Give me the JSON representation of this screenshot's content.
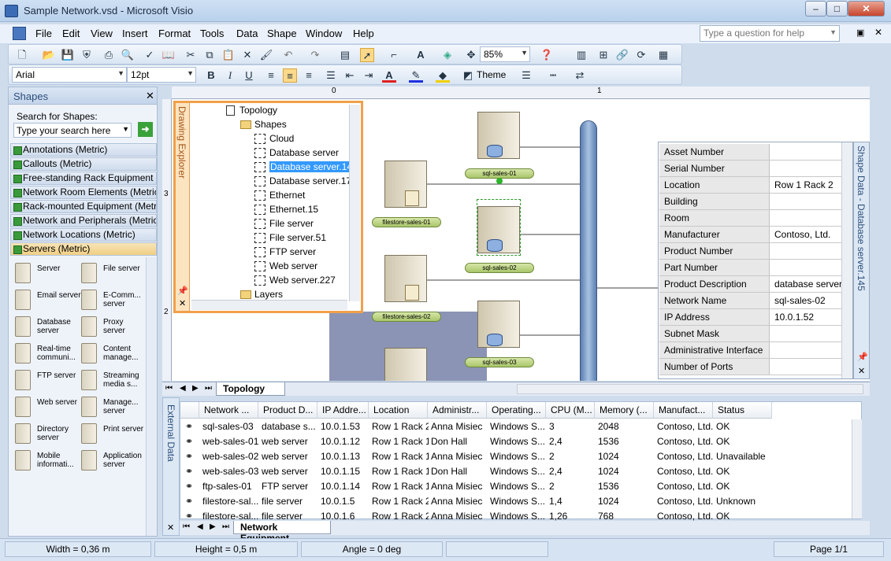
{
  "window": {
    "title": "Sample Network.vsd - Microsoft Visio"
  },
  "menus": [
    "File",
    "Edit",
    "View",
    "Insert",
    "Format",
    "Tools",
    "Data",
    "Shape",
    "Window",
    "Help"
  ],
  "help_placeholder": "Type a question for help",
  "toolbar": {
    "zoom": "85%",
    "font": "Arial",
    "font_size": "12pt",
    "theme_label": "Theme"
  },
  "shapes_panel": {
    "title": "Shapes",
    "search_label": "Search for Shapes:",
    "search_placeholder": "Type your search here",
    "categories": [
      "Annotations (Metric)",
      "Callouts (Metric)",
      "Free-standing Rack Equipment (...",
      "Network Room Elements (Metric)",
      "Rack-mounted Equipment (Metric)",
      "Network and Peripherals (Metric)",
      "Network Locations (Metric)",
      "Servers (Metric)"
    ],
    "stencils": [
      "Server",
      "File server",
      "Email server",
      "E-Comm... server",
      "Database server",
      "Proxy server",
      "Real-time communi...",
      "Content manage...",
      "FTP server",
      "Streaming media s...",
      "Web server",
      "Manage... server",
      "Directory server",
      "Print server",
      "Mobile informati...",
      "Application server"
    ]
  },
  "drawing_explorer": {
    "title": "Drawing Explorer",
    "nodes": [
      "Topology",
      "Shapes",
      "Cloud",
      "Database server",
      "Database server.14",
      "Database server.17",
      "Ethernet",
      "Ethernet.15",
      "File server",
      "File server.51",
      "FTP server",
      "Web server",
      "Web server.227",
      "Layers"
    ]
  },
  "diagram": {
    "labels": [
      "sql-sales-01",
      "filestore-sales-01",
      "sql-sales-02",
      "filestore-sales-02",
      "sql-sales-03"
    ],
    "ruler": [
      "0",
      "1",
      "2",
      "3"
    ],
    "page_tab": "Topology"
  },
  "shape_data": {
    "title": "Shape Data - Database server.145",
    "rows": [
      {
        "k": "Asset Number",
        "v": ""
      },
      {
        "k": "Serial Number",
        "v": ""
      },
      {
        "k": "Location",
        "v": "Row 1 Rack 2"
      },
      {
        "k": "Building",
        "v": ""
      },
      {
        "k": "Room",
        "v": ""
      },
      {
        "k": "Manufacturer",
        "v": "Contoso, Ltd."
      },
      {
        "k": "Product Number",
        "v": ""
      },
      {
        "k": "Part Number",
        "v": ""
      },
      {
        "k": "Product Description",
        "v": "database server"
      },
      {
        "k": "Network Name",
        "v": "sql-sales-02"
      },
      {
        "k": "IP Address",
        "v": "10.0.1.52"
      },
      {
        "k": "Subnet Mask",
        "v": ""
      },
      {
        "k": "Administrative Interface",
        "v": ""
      },
      {
        "k": "Number of Ports",
        "v": ""
      }
    ]
  },
  "external_data": {
    "title": "External Data",
    "columns": [
      "Network ...",
      "Product D...",
      "IP Addre...",
      "Location",
      "Administr...",
      "Operating...",
      "CPU (M...",
      "Memory (...",
      "Manufact...",
      "Status"
    ],
    "rows": [
      [
        "sql-sales-03",
        "database s...",
        "10.0.1.53",
        "Row 1 Rack 2",
        "Anna Misiec",
        "Windows S...",
        "3",
        "2048",
        "Contoso, Ltd.",
        "OK"
      ],
      [
        "web-sales-01",
        "web server",
        "10.0.1.12",
        "Row 1 Rack 1",
        "Don Hall",
        "Windows S...",
        "2,4",
        "1536",
        "Contoso, Ltd.",
        "OK"
      ],
      [
        "web-sales-02",
        "web server",
        "10.0.1.13",
        "Row 1 Rack 1",
        "Anna Misiec",
        "Windows S...",
        "2",
        "1024",
        "Contoso, Ltd.",
        "Unavailable"
      ],
      [
        "web-sales-03",
        "web server",
        "10.0.1.15",
        "Row 1 Rack 1",
        "Don Hall",
        "Windows S...",
        "2,4",
        "1024",
        "Contoso, Ltd.",
        "OK"
      ],
      [
        "ftp-sales-01",
        "FTP server",
        "10.0.1.14",
        "Row 1 Rack 1",
        "Anna Misiec",
        "Windows S...",
        "2",
        "1536",
        "Contoso, Ltd.",
        "OK"
      ],
      [
        "filestore-sal...",
        "file server",
        "10.0.1.5",
        "Row 1 Rack 2",
        "Anna Misiec",
        "Windows S...",
        "1,4",
        "1024",
        "Contoso, Ltd.",
        "Unknown"
      ],
      [
        "filestore-sal...",
        "file server",
        "10.0.1.6",
        "Row 1 Rack 2",
        "Anna Misiec",
        "Windows S...",
        "1,26",
        "768",
        "Contoso, Ltd.",
        "OK"
      ]
    ],
    "tab": "Network Equipment"
  },
  "status": {
    "width": "Width = 0,36 m",
    "height": "Height = 0,5 m",
    "angle": "Angle = 0 deg",
    "page": "Page 1/1"
  }
}
